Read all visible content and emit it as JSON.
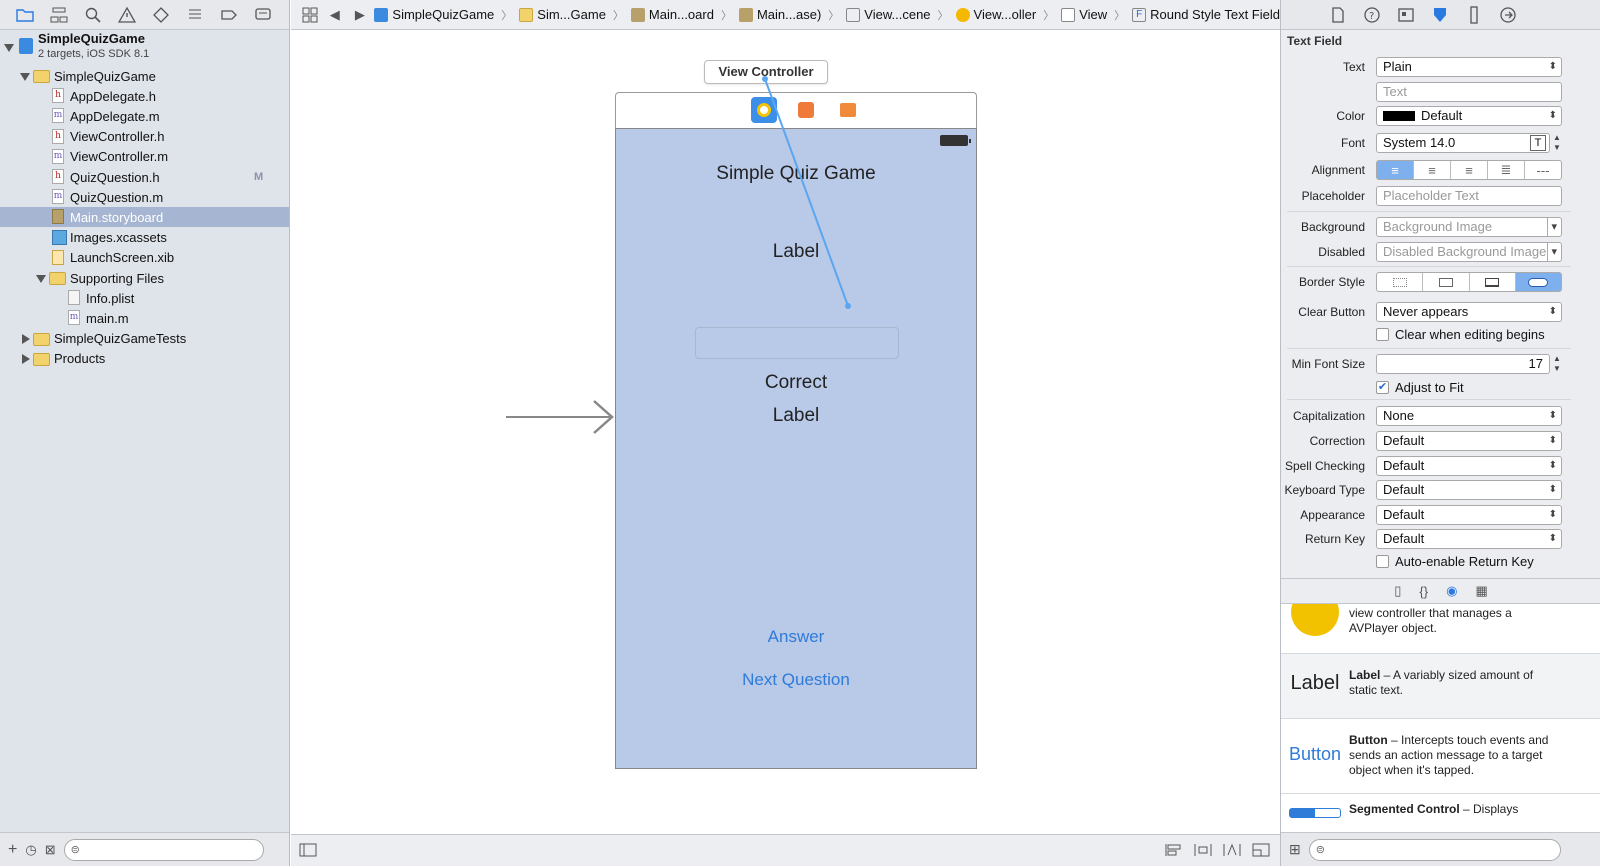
{
  "navigator": {
    "project": {
      "name": "SimpleQuizGame",
      "subtitle": "2 targets, iOS SDK 8.1"
    },
    "items": [
      {
        "label": "SimpleQuizGame",
        "type": "folder",
        "indent": 1,
        "open": true
      },
      {
        "label": "AppDelegate.h",
        "type": "h",
        "indent": 2
      },
      {
        "label": "AppDelegate.m",
        "type": "m",
        "indent": 2
      },
      {
        "label": "ViewController.h",
        "type": "h",
        "indent": 2
      },
      {
        "label": "ViewController.m",
        "type": "m",
        "indent": 2
      },
      {
        "label": "QuizQuestion.h",
        "type": "h",
        "indent": 2,
        "badge": "M"
      },
      {
        "label": "QuizQuestion.m",
        "type": "m",
        "indent": 2
      },
      {
        "label": "Main.storyboard",
        "type": "sb",
        "indent": 2,
        "selected": true
      },
      {
        "label": "Images.xcassets",
        "type": "assets",
        "indent": 2
      },
      {
        "label": "LaunchScreen.xib",
        "type": "xib",
        "indent": 2
      },
      {
        "label": "Supporting Files",
        "type": "folder",
        "indent": 2,
        "open": true
      },
      {
        "label": "Info.plist",
        "type": "plist",
        "indent": 3
      },
      {
        "label": "main.m",
        "type": "m",
        "indent": 3
      },
      {
        "label": "SimpleQuizGameTests",
        "type": "folder",
        "indent": 1,
        "open": false
      },
      {
        "label": "Products",
        "type": "folder",
        "indent": 1,
        "open": false
      }
    ]
  },
  "jumpbar": {
    "crumbs": [
      "SimpleQuizGame",
      "Sim...Game",
      "Main...oard",
      "Main...ase)",
      "View...cene",
      "View...oller",
      "View",
      "Round Style Text Field"
    ]
  },
  "scene": {
    "title": "View Controller",
    "quiz_title": "Simple Quiz Game",
    "question_label": "Label",
    "correct_label": "Correct",
    "result_label": "Label",
    "answer_button": "Answer",
    "next_button": "Next Question"
  },
  "inspector": {
    "section_title": "Text Field",
    "text_label": "Text",
    "text_value": "Plain",
    "text_placeholder": "Text",
    "color_label": "Color",
    "color_value": "Default",
    "color_swatch": "#000000",
    "font_label": "Font",
    "font_value": "System 14.0",
    "alignment_label": "Alignment",
    "placeholder_label": "Placeholder",
    "placeholder_value": "Placeholder Text",
    "background_label": "Background",
    "background_value": "Background Image",
    "disabled_label": "Disabled",
    "disabled_value": "Disabled Background Image",
    "border_label": "Border Style",
    "clear_button_label": "Clear Button",
    "clear_button_value": "Never appears",
    "clear_editing_label": "Clear when editing begins",
    "min_font_label": "Min Font Size",
    "min_font_value": "17",
    "adjust_label": "Adjust to Fit",
    "capitalization_label": "Capitalization",
    "capitalization_value": "None",
    "correction_label": "Correction",
    "correction_value": "Default",
    "spell_label": "Spell Checking",
    "spell_value": "Default",
    "keyboard_label": "Keyboard Type",
    "keyboard_value": "Default",
    "appearance_label": "Appearance",
    "appearance_value": "Default",
    "return_label": "Return Key",
    "return_value": "Default",
    "auto_return_label": "Auto-enable Return Key"
  },
  "library": {
    "avplayer_desc": "view controller that manages a AVPlayer object.",
    "label_icon": "Label",
    "label_title": "Label",
    "label_desc": " – A variably sized amount of static text.",
    "button_icon": "Button",
    "button_title": "Button",
    "button_desc": " – Intercepts touch events and sends an action message to a target object when it's tapped.",
    "segmented_title": "Segmented Control",
    "segmented_desc": " – Displays"
  },
  "colors": {
    "accent": "#2a7ae2",
    "canvas_view": "#b9c9e8",
    "button_text": "#2f7bd8"
  }
}
